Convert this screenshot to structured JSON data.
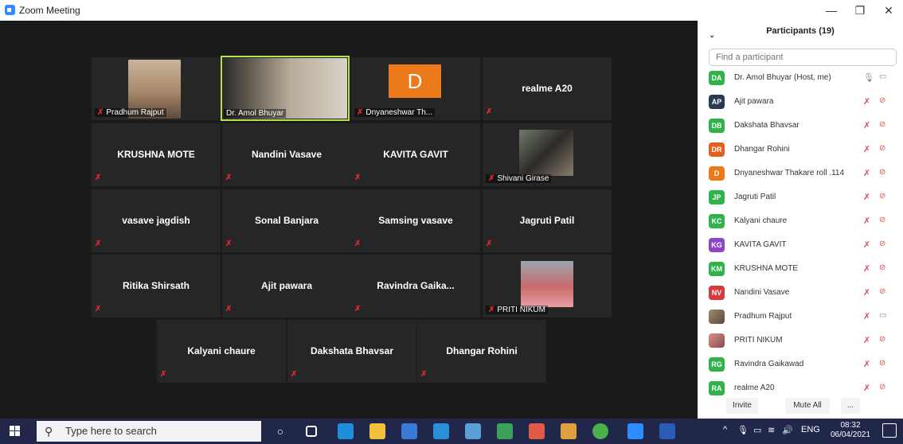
{
  "window": {
    "title": "Zoom Meeting",
    "minimize": "—",
    "restore": "❐",
    "close": "✕"
  },
  "tiles": [
    {
      "name": "Pradhum Rajput"
    },
    {
      "name": "Dr. Amol Bhuyar"
    },
    {
      "name": "Dnyaneshwar Th...",
      "initial": "D"
    },
    {
      "name": "realme A20"
    },
    {
      "name": "KRUSHNA MOTE"
    },
    {
      "name": "Nandini Vasave"
    },
    {
      "name": "KAVITA GAVIT"
    },
    {
      "name": "Shivani Girase"
    },
    {
      "name": "vasave jagdish"
    },
    {
      "name": "Sonal Banjara"
    },
    {
      "name": "Samsing vasave"
    },
    {
      "name": "Jagruti Patil"
    },
    {
      "name": "Ritika Shirsath"
    },
    {
      "name": "Ajit pawara"
    },
    {
      "name": "Ravindra  Gaika..."
    },
    {
      "name": "PRITI NIKUM"
    },
    {
      "name": "Kalyani chaure"
    },
    {
      "name": "Dakshata Bhavsar"
    },
    {
      "name": "Dhangar Rohini"
    }
  ],
  "participants": {
    "title": "Participants (19)",
    "search_placeholder": "Find a participant",
    "list": [
      {
        "initials": "DA",
        "name": "Dr. Amol Bhuyar (Host, me)",
        "color": "#2fb34a"
      },
      {
        "initials": "AP",
        "name": "Ajit pawara",
        "color": "#2b3a55"
      },
      {
        "initials": "DB",
        "name": "Dakshata Bhavsar",
        "color": "#2fb34a"
      },
      {
        "initials": "DR",
        "name": "Dhangar Rohini",
        "color": "#e5601f"
      },
      {
        "initials": "D",
        "name": "Dnyaneshwar Thakare roll .114",
        "color": "#ec7a1b"
      },
      {
        "initials": "JP",
        "name": "Jagruti Patil",
        "color": "#2fb34a"
      },
      {
        "initials": "KC",
        "name": "Kalyani chaure",
        "color": "#2fb34a"
      },
      {
        "initials": "KG",
        "name": "KAVITA GAVIT",
        "color": "#8e44c8"
      },
      {
        "initials": "KM",
        "name": "KRUSHNA MOTE",
        "color": "#2fb34a"
      },
      {
        "initials": "NV",
        "name": "Nandini Vasave",
        "color": "#d63a3a"
      },
      {
        "initials": "",
        "name": "Pradhum Rajput",
        "color": "#7a6a55"
      },
      {
        "initials": "",
        "name": "PRITI NIKUM",
        "color": "#b0504a"
      },
      {
        "initials": "RG",
        "name": "Ravindra Gaikawad",
        "color": "#2fb34a"
      },
      {
        "initials": "RA",
        "name": "realme A20",
        "color": "#2fb34a"
      }
    ],
    "invite_label": "Invite",
    "mute_all_label": "Mute All",
    "more_label": "..."
  },
  "taskbar": {
    "search_placeholder": "Type here to search",
    "lang": "ENG",
    "time": "08:32",
    "date": "06/04/2021"
  }
}
